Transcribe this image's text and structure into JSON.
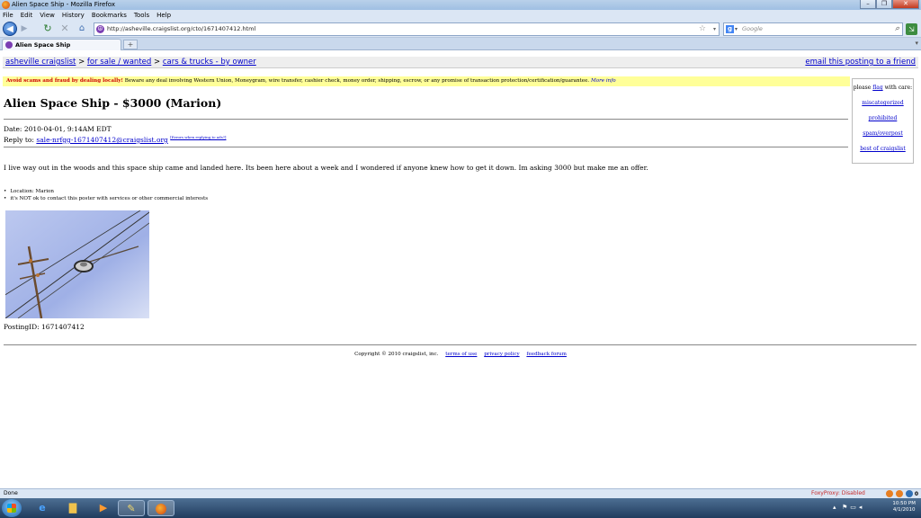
{
  "window": {
    "title": "Alien Space Ship - Mozilla Firefox",
    "controls": [
      "–",
      "❐",
      "✕"
    ]
  },
  "menu": [
    "File",
    "Edit",
    "View",
    "History",
    "Bookmarks",
    "Tools",
    "Help"
  ],
  "nav": {
    "url": "http://asheville.craigslist.org/cto/1671407412.html",
    "search_placeholder": "Google",
    "search_engine_letter": "g"
  },
  "tab": {
    "label": "Alien Space Ship",
    "new_tab": "+"
  },
  "page": {
    "breadcrumbs": [
      "asheville craigslist",
      "for sale / wanted",
      "cars & trucks - by owner"
    ],
    "breadcrumb_sep": ">",
    "email_link": "email this posting to a friend",
    "warning": {
      "hot": "Avoid scams and fraud by dealing locally!",
      "text": " Beware any deal involving Western Union, Moneygram, wire transfer, cashier check, money order, shipping, escrow, or any promise of transaction protection/certification/guarantee. ",
      "more": "More info"
    },
    "flag_box": {
      "please": "please",
      "flag": "flag",
      "with_care": "with care:",
      "links": [
        "miscategorized",
        "prohibited",
        "spam/overpost",
        "best of craigslist"
      ]
    },
    "title": "Alien Space Ship - $3000 (Marion)",
    "date": "Date: 2010-04-01, 9:14AM EDT",
    "reply_label": "Reply to:",
    "reply_email": "sale-nrfgg-1671407412@craigslist.org",
    "reply_hint": "[Errors when replying to ads?]",
    "body": "I live way out in the woods and this space ship came and landed here. Its been here about a week and I wondered if anyone knew how to get it down. Im asking 3000 but make me an offer.",
    "attributes": [
      "Location: Marion",
      "it's NOT ok to contact this poster with services or other commercial interests"
    ],
    "posting_id": "PostingID: 1671407412",
    "footer": {
      "copyright": "Copyright © 2010 craigslist, inc.",
      "links": [
        "terms of use",
        "privacy policy",
        "feedback forum"
      ]
    }
  },
  "status": {
    "left": "Done",
    "foxyproxy": "FoxyProxy: Disabled",
    "count": "0"
  },
  "taskbar": {
    "time": "10:50 PM",
    "date": "4/1/2010"
  }
}
